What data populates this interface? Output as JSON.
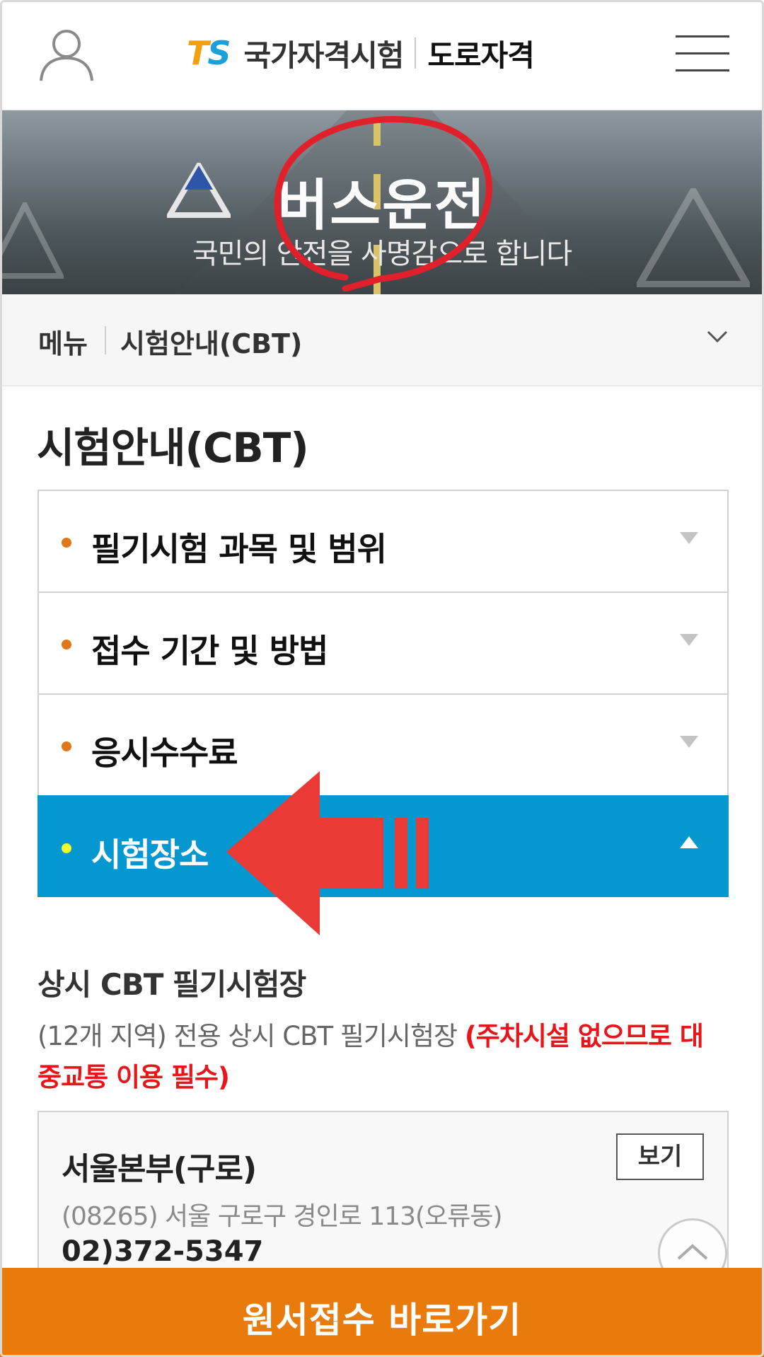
{
  "header": {
    "logo_ts_t": "T",
    "logo_ts_s": "S",
    "site_name": "국가자격시험",
    "site_section": "도로자격"
  },
  "banner": {
    "title": "버스운전",
    "subtitle": "국민의 안전을 사명감으로 합니다"
  },
  "breadcrumb": {
    "menu_label": "메뉴",
    "current": "시험안내(CBT)"
  },
  "page": {
    "title": "시험안내(CBT)"
  },
  "accordion": {
    "items": [
      {
        "label": "필기시험 과목 및 범위",
        "expanded": false
      },
      {
        "label": "접수 기간 및 방법",
        "expanded": false
      },
      {
        "label": "응시수수료",
        "expanded": false
      },
      {
        "label": "시험장소",
        "expanded": true
      }
    ]
  },
  "section": {
    "title": "상시 CBT 필기시험장",
    "desc_normal": "(12개 지역) 전용 상시 CBT 필기시험장 ",
    "desc_warning": "(주차시설 없으므로 대중교통 이용 필수)"
  },
  "location_card": {
    "name": "서울본부(구로)",
    "view_button": "보기",
    "address": "(08265) 서울 구로구 경인로 113(오류동)",
    "phone": "02)372-5347"
  },
  "cta": {
    "label": "원서접수 바로가기"
  },
  "colors": {
    "accent_blue": "#0597cf",
    "cta_orange": "#e87b0c",
    "bullet_orange": "#e2761a",
    "warning_red": "#e8151b",
    "annotation_red": "#e93a35"
  },
  "icons": {
    "profile": "user-icon",
    "menu": "hamburger-menu-icon",
    "breadcrumb_toggle": "chevron-down-icon",
    "scroll_top": "chevron-up-icon"
  }
}
